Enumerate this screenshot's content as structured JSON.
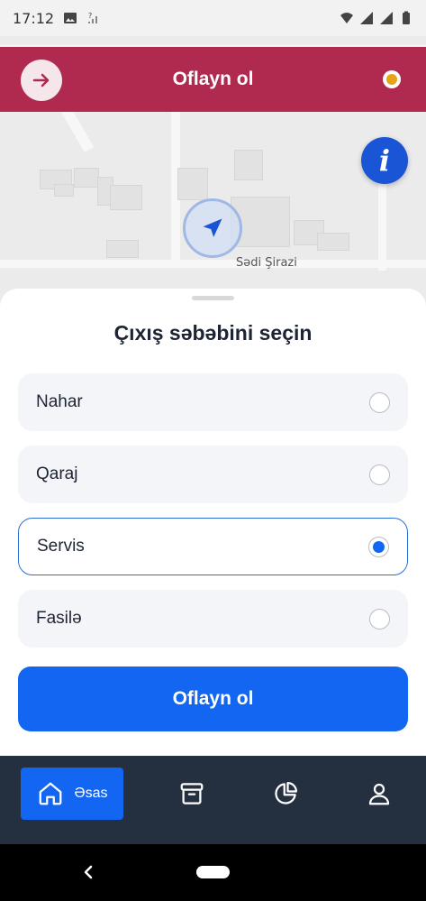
{
  "status_bar": {
    "time": "17:12"
  },
  "map": {
    "street_label": "Sədi Şirazi"
  },
  "header": {
    "title": "Oflayn ol"
  },
  "sheet": {
    "title": "Çıxış səbəbini seçin",
    "options": [
      {
        "label": "Nahar",
        "selected": false
      },
      {
        "label": "Qaraj",
        "selected": false
      },
      {
        "label": "Servis",
        "selected": true
      },
      {
        "label": "Fasilə",
        "selected": false
      }
    ],
    "confirm_label": "Oflayn ol"
  },
  "bottom_nav": {
    "home_label": "Əsas"
  },
  "colors": {
    "header": "#b0294f",
    "accent": "#1266f1",
    "nav": "#242f40",
    "status_online": "#e8a316"
  }
}
